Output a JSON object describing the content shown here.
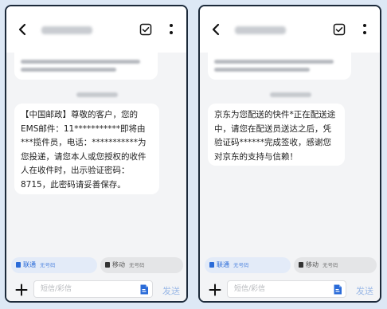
{
  "colors": {
    "background": "#dde8f5",
    "sim1_accent": "#2a6bd8",
    "send_disabled": "#9ab8e6"
  },
  "phones": [
    {
      "message": "【中国邮政】尊敬的客户，您的EMS邮件：11***********即将由***揽件员，电话：***********为您投递，请您本人或您授权的收件人在收件时，出示验证密码：8715，此密码请妥善保存。",
      "sim1": {
        "label": "联通",
        "sub": "无号码"
      },
      "sim2": {
        "label": "移动",
        "sub": "无号码"
      },
      "input_placeholder": "短信/彩信",
      "send_label": "发送",
      "icons": [
        "back-icon",
        "check-square-icon",
        "more-vertical-icon",
        "sim-card-icon",
        "plus-icon",
        "attachment-icon"
      ]
    },
    {
      "message": "京东为您配送的快件*正在配送途中，请您在配送员送达之后，凭验证码******完成签收，感谢您对京东的支持与信赖！",
      "sim1": {
        "label": "联通",
        "sub": "无号码"
      },
      "sim2": {
        "label": "移动",
        "sub": "无号码"
      },
      "input_placeholder": "短信/彩信",
      "send_label": "发送",
      "icons": [
        "back-icon",
        "check-square-icon",
        "more-vertical-icon",
        "sim-card-icon",
        "plus-icon",
        "attachment-icon"
      ]
    }
  ]
}
